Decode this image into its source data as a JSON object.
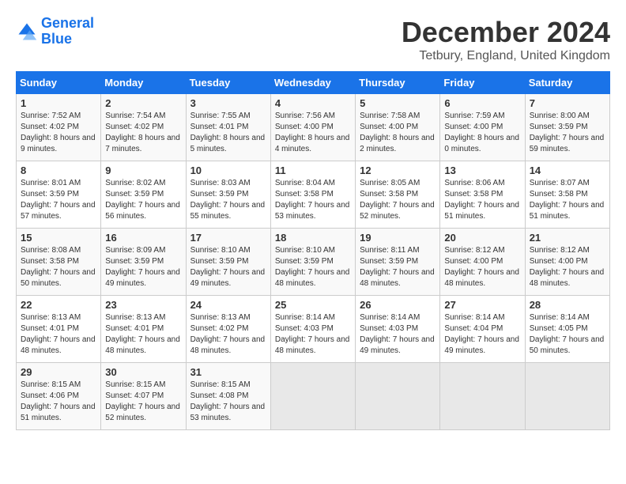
{
  "header": {
    "logo_line1": "General",
    "logo_line2": "Blue",
    "month_title": "December 2024",
    "location": "Tetbury, England, United Kingdom"
  },
  "days_of_week": [
    "Sunday",
    "Monday",
    "Tuesday",
    "Wednesday",
    "Thursday",
    "Friday",
    "Saturday"
  ],
  "weeks": [
    [
      {
        "day": "1",
        "sunrise": "7:52 AM",
        "sunset": "4:02 PM",
        "daylight": "8 hours and 9 minutes."
      },
      {
        "day": "2",
        "sunrise": "7:54 AM",
        "sunset": "4:02 PM",
        "daylight": "8 hours and 7 minutes."
      },
      {
        "day": "3",
        "sunrise": "7:55 AM",
        "sunset": "4:01 PM",
        "daylight": "8 hours and 5 minutes."
      },
      {
        "day": "4",
        "sunrise": "7:56 AM",
        "sunset": "4:00 PM",
        "daylight": "8 hours and 4 minutes."
      },
      {
        "day": "5",
        "sunrise": "7:58 AM",
        "sunset": "4:00 PM",
        "daylight": "8 hours and 2 minutes."
      },
      {
        "day": "6",
        "sunrise": "7:59 AM",
        "sunset": "4:00 PM",
        "daylight": "8 hours and 0 minutes."
      },
      {
        "day": "7",
        "sunrise": "8:00 AM",
        "sunset": "3:59 PM",
        "daylight": "7 hours and 59 minutes."
      }
    ],
    [
      {
        "day": "8",
        "sunrise": "8:01 AM",
        "sunset": "3:59 PM",
        "daylight": "7 hours and 57 minutes."
      },
      {
        "day": "9",
        "sunrise": "8:02 AM",
        "sunset": "3:59 PM",
        "daylight": "7 hours and 56 minutes."
      },
      {
        "day": "10",
        "sunrise": "8:03 AM",
        "sunset": "3:59 PM",
        "daylight": "7 hours and 55 minutes."
      },
      {
        "day": "11",
        "sunrise": "8:04 AM",
        "sunset": "3:58 PM",
        "daylight": "7 hours and 53 minutes."
      },
      {
        "day": "12",
        "sunrise": "8:05 AM",
        "sunset": "3:58 PM",
        "daylight": "7 hours and 52 minutes."
      },
      {
        "day": "13",
        "sunrise": "8:06 AM",
        "sunset": "3:58 PM",
        "daylight": "7 hours and 51 minutes."
      },
      {
        "day": "14",
        "sunrise": "8:07 AM",
        "sunset": "3:58 PM",
        "daylight": "7 hours and 51 minutes."
      }
    ],
    [
      {
        "day": "15",
        "sunrise": "8:08 AM",
        "sunset": "3:58 PM",
        "daylight": "7 hours and 50 minutes."
      },
      {
        "day": "16",
        "sunrise": "8:09 AM",
        "sunset": "3:59 PM",
        "daylight": "7 hours and 49 minutes."
      },
      {
        "day": "17",
        "sunrise": "8:10 AM",
        "sunset": "3:59 PM",
        "daylight": "7 hours and 49 minutes."
      },
      {
        "day": "18",
        "sunrise": "8:10 AM",
        "sunset": "3:59 PM",
        "daylight": "7 hours and 48 minutes."
      },
      {
        "day": "19",
        "sunrise": "8:11 AM",
        "sunset": "3:59 PM",
        "daylight": "7 hours and 48 minutes."
      },
      {
        "day": "20",
        "sunrise": "8:12 AM",
        "sunset": "4:00 PM",
        "daylight": "7 hours and 48 minutes."
      },
      {
        "day": "21",
        "sunrise": "8:12 AM",
        "sunset": "4:00 PM",
        "daylight": "7 hours and 48 minutes."
      }
    ],
    [
      {
        "day": "22",
        "sunrise": "8:13 AM",
        "sunset": "4:01 PM",
        "daylight": "7 hours and 48 minutes."
      },
      {
        "day": "23",
        "sunrise": "8:13 AM",
        "sunset": "4:01 PM",
        "daylight": "7 hours and 48 minutes."
      },
      {
        "day": "24",
        "sunrise": "8:13 AM",
        "sunset": "4:02 PM",
        "daylight": "7 hours and 48 minutes."
      },
      {
        "day": "25",
        "sunrise": "8:14 AM",
        "sunset": "4:03 PM",
        "daylight": "7 hours and 48 minutes."
      },
      {
        "day": "26",
        "sunrise": "8:14 AM",
        "sunset": "4:03 PM",
        "daylight": "7 hours and 49 minutes."
      },
      {
        "day": "27",
        "sunrise": "8:14 AM",
        "sunset": "4:04 PM",
        "daylight": "7 hours and 49 minutes."
      },
      {
        "day": "28",
        "sunrise": "8:14 AM",
        "sunset": "4:05 PM",
        "daylight": "7 hours and 50 minutes."
      }
    ],
    [
      {
        "day": "29",
        "sunrise": "8:15 AM",
        "sunset": "4:06 PM",
        "daylight": "7 hours and 51 minutes."
      },
      {
        "day": "30",
        "sunrise": "8:15 AM",
        "sunset": "4:07 PM",
        "daylight": "7 hours and 52 minutes."
      },
      {
        "day": "31",
        "sunrise": "8:15 AM",
        "sunset": "4:08 PM",
        "daylight": "7 hours and 53 minutes."
      },
      null,
      null,
      null,
      null
    ]
  ]
}
